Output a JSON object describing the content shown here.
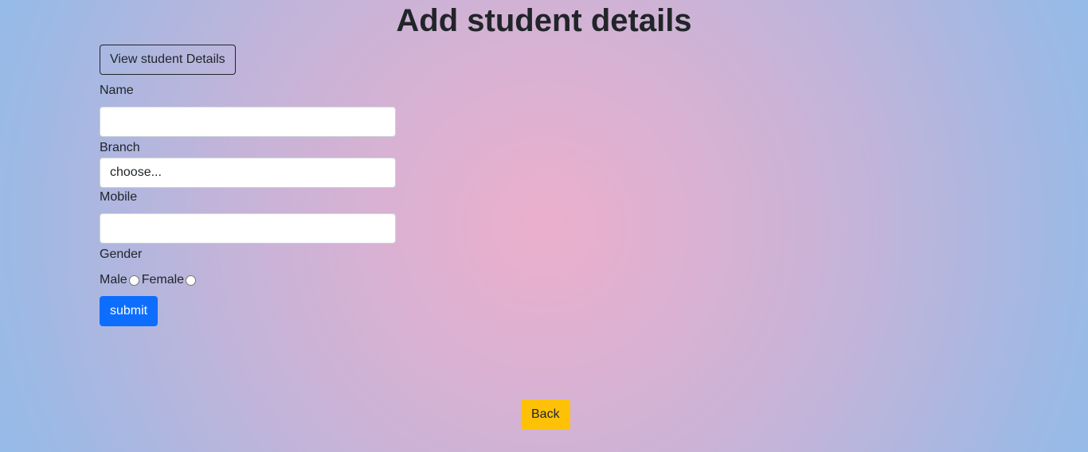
{
  "page": {
    "title": "Add student details"
  },
  "form": {
    "view_button_label": "View student Details",
    "name_label": "Name",
    "name_value": "",
    "branch_label": "Branch",
    "branch_selected": "choose...",
    "mobile_label": "Mobile",
    "mobile_value": "",
    "gender_label": "Gender",
    "gender_options": [
      "Male",
      "Female"
    ],
    "submit_label": "submit"
  },
  "footer": {
    "back_label": "Back"
  },
  "colors": {
    "primary": "#0d6efd",
    "warning": "#ffc107",
    "text": "#212529"
  }
}
